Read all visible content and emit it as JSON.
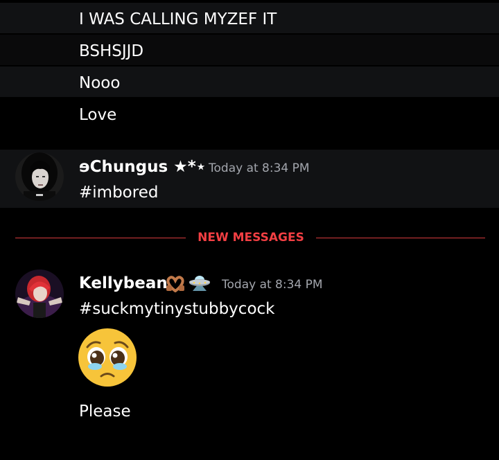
{
  "messages_top": [
    {
      "text": "I WAS CALLING MYZEF IT"
    },
    {
      "text": "BSHSJJD"
    },
    {
      "text": "Nooo"
    },
    {
      "text": "Love"
    }
  ],
  "message_chungus": {
    "username": "ɘChungus ★*⋆",
    "timestamp": "Today at 8:34 PM",
    "text": "#imbored"
  },
  "divider": {
    "label": "NEW MESSAGES",
    "color": "#f23f43"
  },
  "message_kellybean": {
    "username": "Kellybean",
    "timestamp": "Today at 8:34 PM",
    "text": "#suckmytinystubbycock",
    "emoji": "pleading-face-emoji",
    "followup_text": "Please"
  },
  "colors": {
    "background": "#000000",
    "highlight_row": "#111214",
    "timestamp": "#a3a6ad",
    "accent_red": "#f23f43"
  }
}
